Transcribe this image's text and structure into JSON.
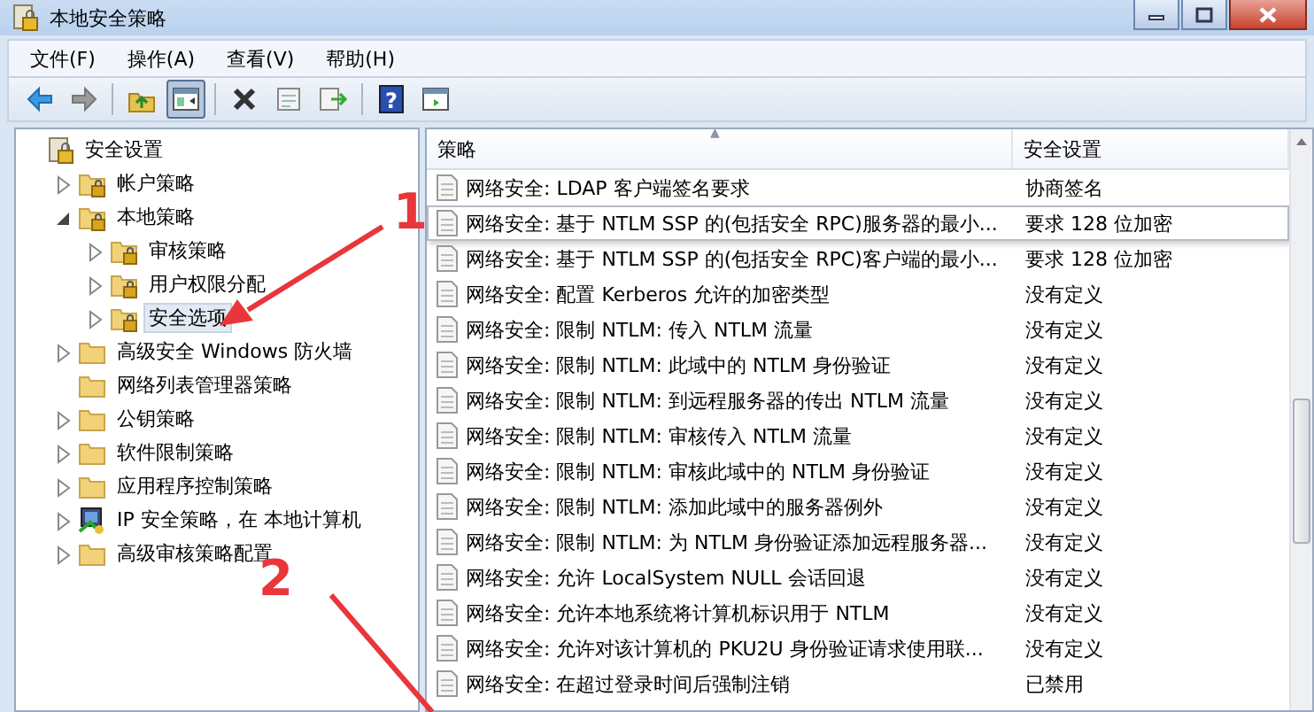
{
  "window": {
    "title": "本地安全策略"
  },
  "menu": [
    {
      "label": "文件(F)"
    },
    {
      "label": "操作(A)"
    },
    {
      "label": "查看(V)"
    },
    {
      "label": "帮助(H)"
    }
  ],
  "toolbar": [
    {
      "kind": "back",
      "pressed": false
    },
    {
      "kind": "forward",
      "pressed": false
    },
    {
      "kind": "separator"
    },
    {
      "kind": "up",
      "pressed": false
    },
    {
      "kind": "tree",
      "pressed": true
    },
    {
      "kind": "separator"
    },
    {
      "kind": "delete",
      "pressed": false
    },
    {
      "kind": "properties",
      "pressed": false
    },
    {
      "kind": "export",
      "pressed": false
    },
    {
      "kind": "separator"
    },
    {
      "kind": "help",
      "label": "?",
      "pressed": false
    },
    {
      "kind": "pane",
      "pressed": false
    }
  ],
  "tree": [
    {
      "label": "安全设置",
      "kind": "lock-document",
      "selected": false,
      "children": [
        {
          "label": "帐户策略",
          "kind": "lock-folder",
          "expanded": false,
          "selected": false
        },
        {
          "label": "本地策略",
          "kind": "lock-folder",
          "expanded": true,
          "selected": false,
          "children": [
            {
              "label": "审核策略",
              "kind": "lock-folder",
              "expanded": false,
              "selected": false
            },
            {
              "label": "用户权限分配",
              "kind": "lock-folder",
              "expanded": false,
              "selected": false
            },
            {
              "label": "安全选项",
              "kind": "lock-folder",
              "expanded": false,
              "selected": true
            }
          ]
        },
        {
          "label": "高级安全 Windows 防火墙",
          "kind": "folder",
          "expanded": false,
          "selected": false
        },
        {
          "label": "网络列表管理器策略",
          "kind": "folder",
          "selected": false
        },
        {
          "label": "公钥策略",
          "kind": "folder",
          "expanded": false,
          "selected": false
        },
        {
          "label": "软件限制策略",
          "kind": "folder",
          "expanded": false,
          "selected": false
        },
        {
          "label": "应用程序控制策略",
          "kind": "folder",
          "expanded": false,
          "selected": false
        },
        {
          "label": "IP 安全策略，在 本地计算机",
          "kind": "computer",
          "expanded": false,
          "selected": false
        },
        {
          "label": "高级审核策略配置",
          "kind": "folder",
          "expanded": false,
          "selected": false
        }
      ]
    }
  ],
  "table": {
    "columns": [
      "策略",
      "安全设置"
    ],
    "sort_mark": "▲",
    "rows": [
      {
        "policy": "网络安全: LDAP 客户端签名要求",
        "setting": "协商签名",
        "hovered": false
      },
      {
        "policy": "网络安全: 基于 NTLM SSP 的(包括安全 RPC)服务器的最小...",
        "setting": "要求 128 位加密",
        "hovered": true
      },
      {
        "policy": "网络安全: 基于 NTLM SSP 的(包括安全 RPC)客户端的最小...",
        "setting": "要求 128 位加密",
        "hovered": false
      },
      {
        "policy": "网络安全: 配置 Kerberos 允许的加密类型",
        "setting": "没有定义",
        "hovered": false
      },
      {
        "policy": "网络安全: 限制 NTLM: 传入 NTLM 流量",
        "setting": "没有定义",
        "hovered": false
      },
      {
        "policy": "网络安全: 限制 NTLM: 此域中的 NTLM 身份验证",
        "setting": "没有定义",
        "hovered": false
      },
      {
        "policy": "网络安全: 限制 NTLM: 到远程服务器的传出 NTLM 流量",
        "setting": "没有定义",
        "hovered": false
      },
      {
        "policy": "网络安全: 限制 NTLM: 审核传入 NTLM 流量",
        "setting": "没有定义",
        "hovered": false
      },
      {
        "policy": "网络安全: 限制 NTLM: 审核此域中的 NTLM 身份验证",
        "setting": "没有定义",
        "hovered": false
      },
      {
        "policy": "网络安全: 限制 NTLM: 添加此域中的服务器例外",
        "setting": "没有定义",
        "hovered": false
      },
      {
        "policy": "网络安全: 限制 NTLM: 为 NTLM 身份验证添加远程服务器...",
        "setting": "没有定义",
        "hovered": false
      },
      {
        "policy": "网络安全: 允许 LocalSystem NULL 会话回退",
        "setting": "没有定义",
        "hovered": false
      },
      {
        "policy": "网络安全: 允许本地系统将计算机标识用于 NTLM",
        "setting": "没有定义",
        "hovered": false
      },
      {
        "policy": "网络安全: 允许对该计算机的 PKU2U 身份验证请求使用联...",
        "setting": "没有定义",
        "hovered": false
      },
      {
        "policy": "网络安全: 在超过登录时间后强制注销",
        "setting": "已禁用",
        "hovered": false
      }
    ]
  },
  "annotations": [
    {
      "label": "1"
    },
    {
      "label": "2"
    }
  ]
}
